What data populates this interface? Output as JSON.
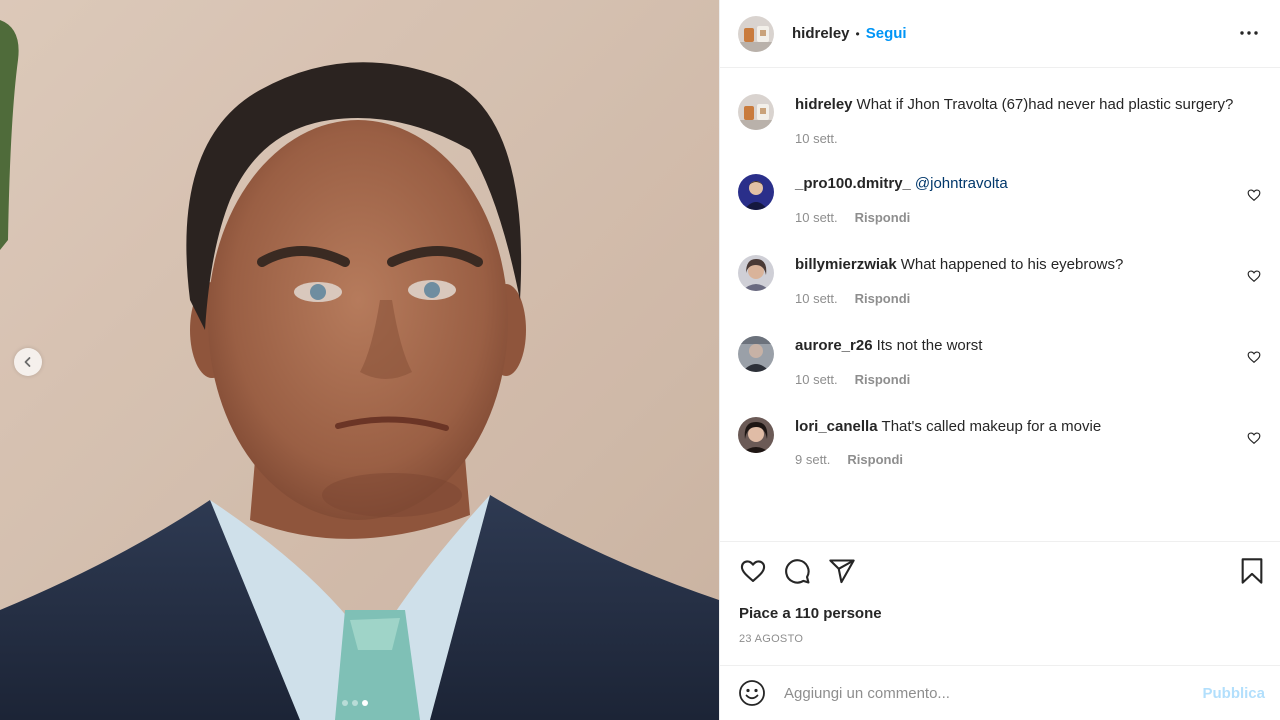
{
  "post": {
    "author": "hidreley",
    "separator": "•",
    "follow_label": "Segui",
    "more_icon": "more-horizontal-icon"
  },
  "media": {
    "prev_icon": "chevron-left-icon",
    "dots_total": 3,
    "active_dot": 3
  },
  "caption": {
    "username": "hidreley",
    "text": "What if Jhon Travolta (67)had never had plastic surgery?",
    "time": "10 sett."
  },
  "comments": [
    {
      "username": "_pro100.dmitry_",
      "text": "",
      "mention": "@johntravolta",
      "time": "10 sett.",
      "reply": "Rispondi"
    },
    {
      "username": "billymierzwiak",
      "text": "What happened to his eyebrows?",
      "mention": "",
      "time": "10 sett.",
      "reply": "Rispondi"
    },
    {
      "username": "aurore_r26",
      "text": "Its not the worst",
      "mention": "",
      "time": "10 sett.",
      "reply": "Rispondi"
    },
    {
      "username": "lori_canella",
      "text": "That's called makeup for a movie",
      "mention": "",
      "time": "9 sett.",
      "reply": "Rispondi"
    }
  ],
  "actions": {
    "like_icon": "heart-icon",
    "comment_icon": "comment-bubble-icon",
    "share_icon": "paper-plane-icon",
    "save_icon": "bookmark-icon"
  },
  "likes_text": "Piace a 110 persone",
  "date_text": "23 AGOSTO",
  "add_comment": {
    "placeholder": "Aggiungi un commento...",
    "value": "",
    "publish_label": "Pubblica",
    "emoji_icon": "emoji-smile-icon"
  },
  "colors": {
    "link_blue": "#0095f6",
    "mention_blue": "#00376b",
    "publish_disabled": "#b2dffc",
    "muted_text": "#8e8e8e"
  }
}
